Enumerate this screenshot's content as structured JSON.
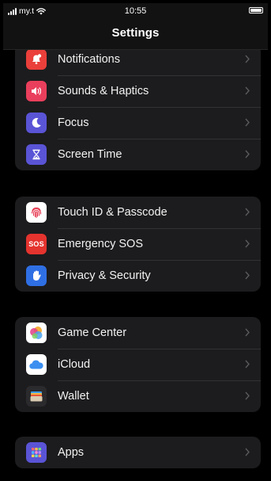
{
  "status_bar": {
    "carrier": "my.t",
    "time": "10:55"
  },
  "nav": {
    "title": "Settings"
  },
  "groups": [
    {
      "items": [
        {
          "label": "Notifications",
          "icon": "bell-badge-icon",
          "color": "#ea3f3a"
        },
        {
          "label": "Sounds & Haptics",
          "icon": "speaker-icon",
          "color": "#ea3f5c"
        },
        {
          "label": "Focus",
          "icon": "moon-icon",
          "color": "#5a54d6"
        },
        {
          "label": "Screen Time",
          "icon": "hourglass-icon",
          "color": "#5a54d6"
        }
      ]
    },
    {
      "items": [
        {
          "label": "Touch ID & Passcode",
          "icon": "fingerprint-icon",
          "color": "#ffffff"
        },
        {
          "label": "Emergency SOS",
          "icon": "sos-icon",
          "color": "#e5332e",
          "icon_text": "SOS"
        },
        {
          "label": "Privacy & Security",
          "icon": "hand-icon",
          "color": "#2f6fe4"
        }
      ]
    },
    {
      "items": [
        {
          "label": "Game Center",
          "icon": "game-center-icon",
          "color": "#ffffff"
        },
        {
          "label": "iCloud",
          "icon": "cloud-icon",
          "color": "#ffffff"
        },
        {
          "label": "Wallet",
          "icon": "wallet-icon",
          "color": "#2b2b2d"
        }
      ]
    },
    {
      "items": [
        {
          "label": "Apps",
          "icon": "apps-grid-icon",
          "color": "#5a54d6"
        }
      ]
    }
  ]
}
